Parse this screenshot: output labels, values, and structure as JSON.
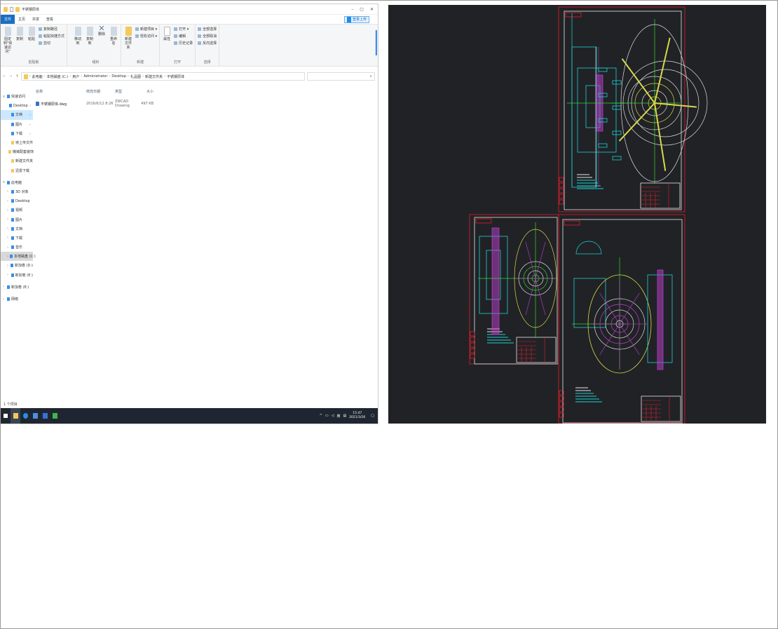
{
  "window": {
    "title": "不锈钢原体",
    "min": "–",
    "max": "▢",
    "close": "✕"
  },
  "tabs": [
    {
      "label": "文件"
    },
    {
      "label": "主页"
    },
    {
      "label": "共享"
    },
    {
      "label": "查看"
    }
  ],
  "login_label": "登录上传",
  "ribbon": {
    "clipboard": {
      "label": "剪贴板",
      "pin": "固定到\"快速访问\"",
      "copy": "复制",
      "paste": "粘贴",
      "copy_path": "复制路径",
      "paste_shortcut": "粘贴快捷方式",
      "cut": "剪切"
    },
    "organize": {
      "label": "组织",
      "move_to": "移动到",
      "copy_to": "复制到",
      "delete": "删除",
      "rename": "重命名"
    },
    "new": {
      "label": "新建",
      "new_folder": "新建文件夹",
      "new_item": "新建项目 ▾",
      "easy_access": "轻松访问 ▾"
    },
    "open": {
      "label": "打开",
      "properties": "属性",
      "open": "打开 ▾",
      "edit": "编辑",
      "history": "历史记录"
    },
    "select": {
      "label": "选择",
      "select_all": "全部选择",
      "select_none": "全部取消",
      "invert": "反向选择"
    }
  },
  "breadcrumb": [
    "此电脑",
    "本地磁盘 (C:)",
    "用户",
    "Administrator",
    "Desktop",
    "礼品图",
    "新建文件夹",
    "不锈钢原体"
  ],
  "search_icon": "search-icon",
  "nav": {
    "quick_access": "快速访问",
    "quick": [
      {
        "label": "Desktop",
        "pinned": true
      },
      {
        "label": "文档",
        "pinned": true
      },
      {
        "label": "图片",
        "pinned": true
      },
      {
        "label": "下载",
        "pinned": true
      },
      {
        "label": "待上传文件"
      },
      {
        "label": "機械配套装饰"
      },
      {
        "label": "新建文件夹"
      },
      {
        "label": "迅雷下载"
      }
    ],
    "this_pc": "此电脑",
    "pc": [
      {
        "label": "3D 对象"
      },
      {
        "label": "Desktop"
      },
      {
        "label": "视频"
      },
      {
        "label": "图片"
      },
      {
        "label": "文档"
      },
      {
        "label": "下载"
      },
      {
        "label": "音乐"
      },
      {
        "label": "本地磁盘 (C:)"
      },
      {
        "label": "新加卷 (D:)"
      },
      {
        "label": "新加卷 (E:)"
      }
    ],
    "drive_e": "新加卷 (E:)",
    "network": "网络"
  },
  "columns": [
    "名称",
    "修改日期",
    "类型",
    "大小"
  ],
  "files": [
    {
      "name": "不锈钢原体.dwg",
      "modified": "2016/6/12 8:26",
      "type": "ZWCAD Drawing",
      "size": "497 KB"
    }
  ],
  "status": "1 个项目",
  "taskbar": {
    "ime": "英",
    "time": "15:47",
    "date": "2021/3/26"
  },
  "colors": {
    "accent": "#1a6fc2",
    "taskbar": "#1f2631",
    "cad_bg": "#212226",
    "cad_red": "#e0202a",
    "cad_cyan": "#19d3d3",
    "cad_magenta": "#c040d0",
    "cad_green": "#2ed82e",
    "cad_yellow": "#d8d84a"
  }
}
